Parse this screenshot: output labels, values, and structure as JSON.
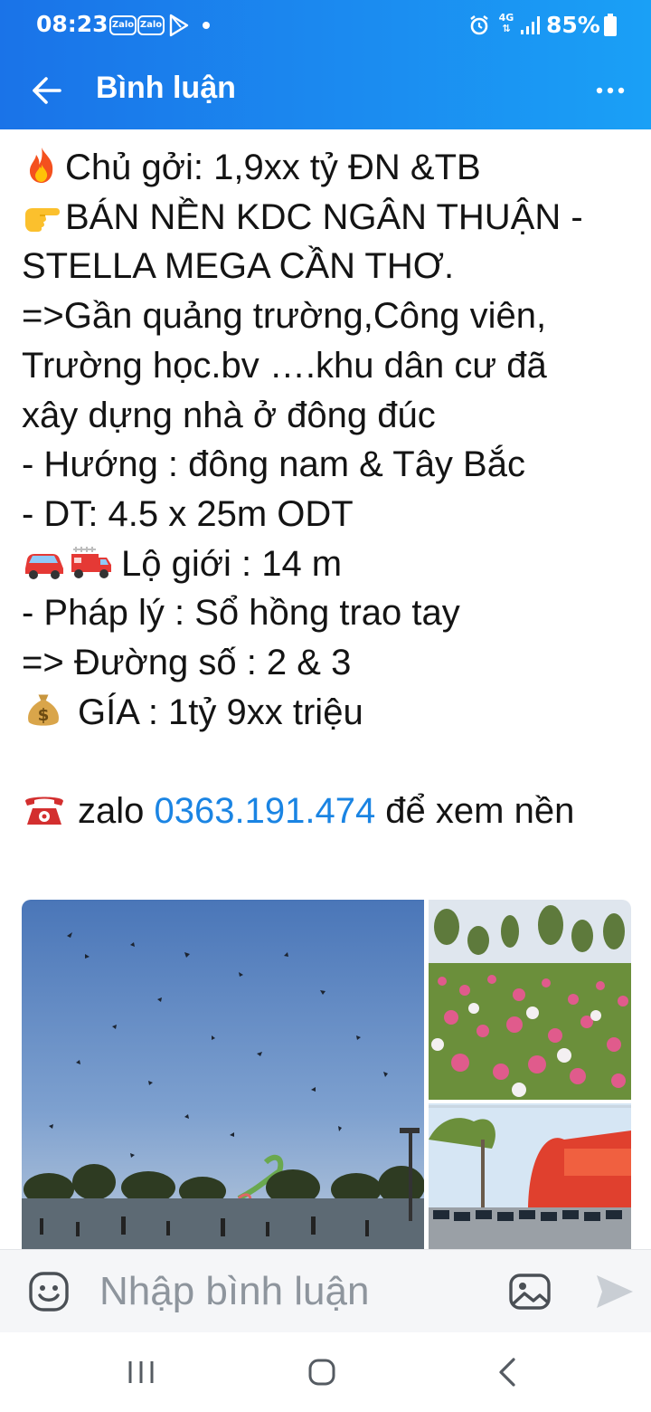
{
  "status_bar": {
    "time": "08:23",
    "notification_badges": [
      "Zalo",
      "Zalo"
    ],
    "network": "4G",
    "battery": "85%"
  },
  "header": {
    "title": "Bình luận"
  },
  "post": {
    "lines": {
      "l1": "Chủ gởi: 1,9xx tỷ ĐN &TB",
      "l2": "BÁN NỀN KDC NGÂN THUẬN -",
      "l3": "STELLA MEGA CẦN THƠ.",
      "l4": "=>Gần quảng trường,Công viên,",
      "l5": "Trường học.bv ….khu dân cư đã",
      "l6": "xây dựng nhà ở đông đúc",
      "l7": "- Hướng : đông nam & Tây Bắc",
      "l8": "- DT: 4.5 x 25m ODT",
      "l9": "Lộ giới : 14 m",
      "l10": "- Pháp lý : Sổ hồng trao tay",
      "l11": "=> Đường số : 2 & 3",
      "l12": "GÍA : 1tỷ 9xx triệu",
      "zalo_prefix": "zalo ",
      "phone": "0363.191.474",
      "zalo_suffix": " để xem nền"
    },
    "emojis": [
      "fire-emoji",
      "pointing-hand-emoji",
      "car-emoji",
      "fire-truck-emoji",
      "money-bag-emoji",
      "telephone-emoji"
    ],
    "link_color": "#1a84e3"
  },
  "photos": [
    "kites-over-park-photo",
    "flower-field-photo",
    "entrance-gate-photo"
  ],
  "comment_bar": {
    "placeholder": "Nhập bình luận"
  },
  "colors": {
    "header_gradient_start": "#1a73e8",
    "header_gradient_end": "#1aa0f6"
  }
}
